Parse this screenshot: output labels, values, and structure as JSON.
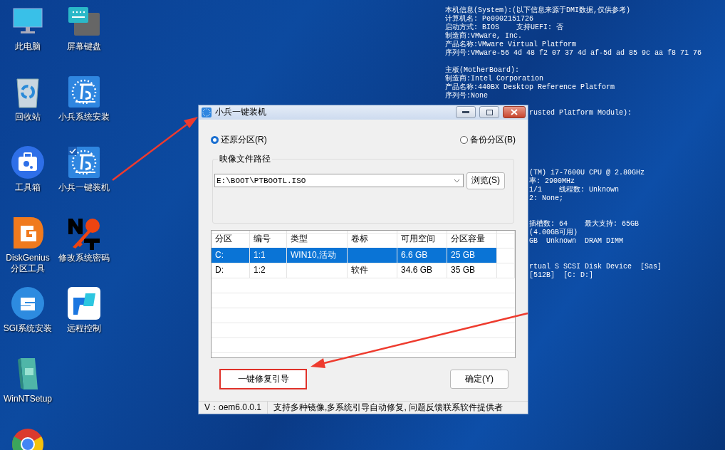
{
  "desktop_icons": [
    {
      "label": "此电脑",
      "kind": "monitor",
      "selected": false
    },
    {
      "label": "回收站",
      "kind": "recycle-bin",
      "selected": false
    },
    {
      "label": "工具箱",
      "kind": "toolbox",
      "selected": false
    },
    {
      "label": "DiskGenius\n分区工具",
      "kind": "disk-tool",
      "selected": false
    },
    {
      "label": "SGI系统安装",
      "kind": "sgi",
      "selected": false
    },
    {
      "label": "WinNTSetup",
      "kind": "setup-box",
      "selected": false
    },
    {
      "kind": "browser",
      "selected": false
    },
    {
      "label": "屏幕键盘",
      "kind": "keyboard",
      "selected": false
    },
    {
      "label": "小兵系统安装",
      "kind": "installer",
      "selected": false
    },
    {
      "label": "小兵一键装机",
      "kind": "installer",
      "selected": true
    },
    {
      "label": "修改系统密码",
      "kind": "key",
      "selected": false
    },
    {
      "label": "远程控制",
      "kind": "remote",
      "selected": false
    }
  ],
  "system_info": {
    "sections": [
      {
        "lines": [
          "本机信息(System):(以下信息来源于DMI数据,仅供参考)",
          "计算机名: Pe0902151726",
          "启动方式: BIOS    支持UEFI: 否",
          "制造商:VMware, Inc.",
          "产品名称:VMware Virtual Platform",
          "序列号:VMware-56 4d 48 f2 07 37 4d af-5d ad 85 9c aa f8 71 76"
        ]
      },
      {
        "lines": [
          "主板(MotherBoard):",
          "制造商:Intel Corporation",
          "产品名称:440BX Desktop Reference Platform",
          "序列号:None"
        ]
      }
    ],
    "partial_sections": [
      {
        "lines": [
          "rusted Platform Module):"
        ]
      },
      {
        "lines": [
          "(TM) i7-7600U CPU @ 2.80GHz",
          "率: 2900MHz",
          "1/1    线程数: Unknown",
          "2: None;"
        ]
      },
      {
        "lines": [
          "插槽数: 64    最大支持: 65GB",
          "(4.00GB可用)",
          "GB  Unknown  DRAM DIMM"
        ]
      },
      {
        "lines": [
          "rtual S SCSI Disk Device  [Sas]",
          "[512B]  [C: D:]"
        ]
      }
    ]
  },
  "window": {
    "title": "小兵一键装机",
    "modes": [
      {
        "label": "还原分区(R)",
        "selected": true
      },
      {
        "label": "备份分区(B)",
        "selected": false
      }
    ],
    "image_path": {
      "label": "映像文件路径",
      "value": "E:\\BOOT\\PTBOOTL.ISO",
      "browse_button": "浏览(S)"
    },
    "table": {
      "columns": [
        "分区",
        "编号",
        "类型",
        "卷标",
        "可用空间",
        "分区容量"
      ],
      "rows": [
        {
          "cells": [
            "C:",
            "1:1",
            "WIN10,活动",
            "",
            "6.6 GB",
            "25 GB"
          ],
          "selected": true
        },
        {
          "cells": [
            "D:",
            "1:2",
            "",
            "软件",
            "34.6 GB",
            "35 GB"
          ],
          "selected": false
        }
      ]
    },
    "repair_button": "一键修复引导",
    "ok_button": "确定(Y)",
    "status_bar": {
      "version": "V：oem6.0.0.1",
      "message": "支持多种镜像,多系统引导自动修复, 问题反馈联系软件提供者"
    }
  }
}
